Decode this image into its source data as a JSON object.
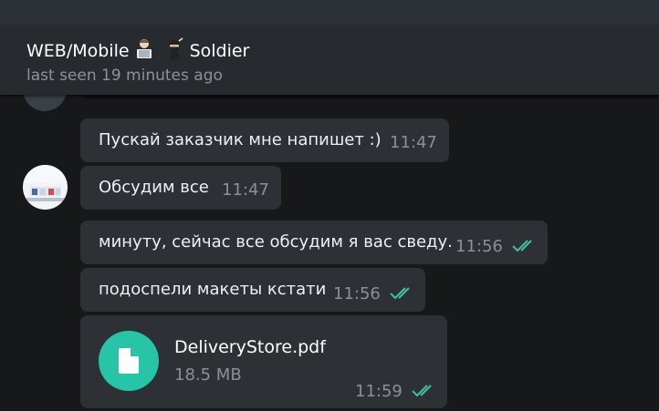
{
  "header": {
    "title_part1": "WEB/Mobile",
    "title_part2": "Soldier",
    "status": "last seen 19 minutes ago"
  },
  "messages": [
    {
      "text": "Пускай заказчик мне напишет :)",
      "time": "11:47",
      "direction": "incoming"
    },
    {
      "text": "Обсудим все",
      "time": "11:47",
      "direction": "incoming"
    },
    {
      "text": "минуту, сейчас все обсудим я вас сведу.",
      "time": "11:56",
      "direction": "outgoing",
      "read": true
    },
    {
      "text": "подоспели макеты кстати",
      "time": "11:56",
      "direction": "outgoing",
      "read": true
    }
  ],
  "file_message": {
    "file_name": "DeliveryStore.pdf",
    "file_size": "18.5 MB",
    "time": "11:59",
    "read": true
  },
  "colors": {
    "background": "#171819",
    "header": "#272b30",
    "bubble": "#2d3136",
    "accent": "#27c4a8",
    "check": "#3fc1a5"
  },
  "icons": [
    "laptop-person-emoji",
    "ninja-emoji",
    "double-check-icon",
    "document-icon"
  ]
}
